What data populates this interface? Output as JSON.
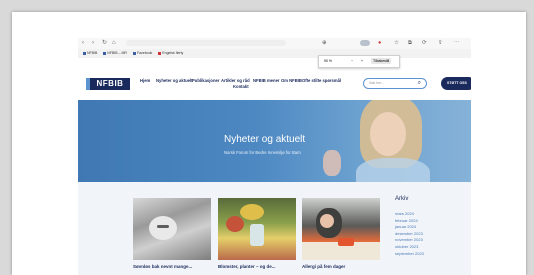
{
  "bookmarks": [
    "NFBIB",
    "NFBIB – MR",
    "Facebook",
    "Engelsk flerty"
  ],
  "zoom": {
    "level": "90 %",
    "minus": "−",
    "plus": "+",
    "reset_label": "Tilbakestill"
  },
  "site": {
    "logo": "NFBIB",
    "menu": [
      "Hjem",
      "Nyheter og aktuelt",
      "Publikasjoner",
      "Artikler og råd",
      "NFBIB mener",
      "Om NFBIB",
      "Ofte stilte spørsmål",
      "Kontakt"
    ],
    "search_placeholder": "Søk her...",
    "start_button": "STØTT OSS"
  },
  "hero": {
    "title": "Nyheter og aktuelt",
    "subtitle": "Norsk Forum for Bedre Innemiljø for Barn"
  },
  "posts": [
    {
      "title": "Søvnløs bak nevnt mange..."
    },
    {
      "title": "Blomster, planter – og de..."
    },
    {
      "title": "Allergi på fem dager"
    }
  ],
  "archive": {
    "title": "Arkiv",
    "items": [
      "mars 2024",
      "februar 2024",
      "januar 2024",
      "desember 2023",
      "november 2023",
      "oktober 2023",
      "september 2023"
    ]
  },
  "colors": {
    "brand": "#1b2a5c",
    "accent": "#5c93d1",
    "link": "#4a7bb8"
  }
}
